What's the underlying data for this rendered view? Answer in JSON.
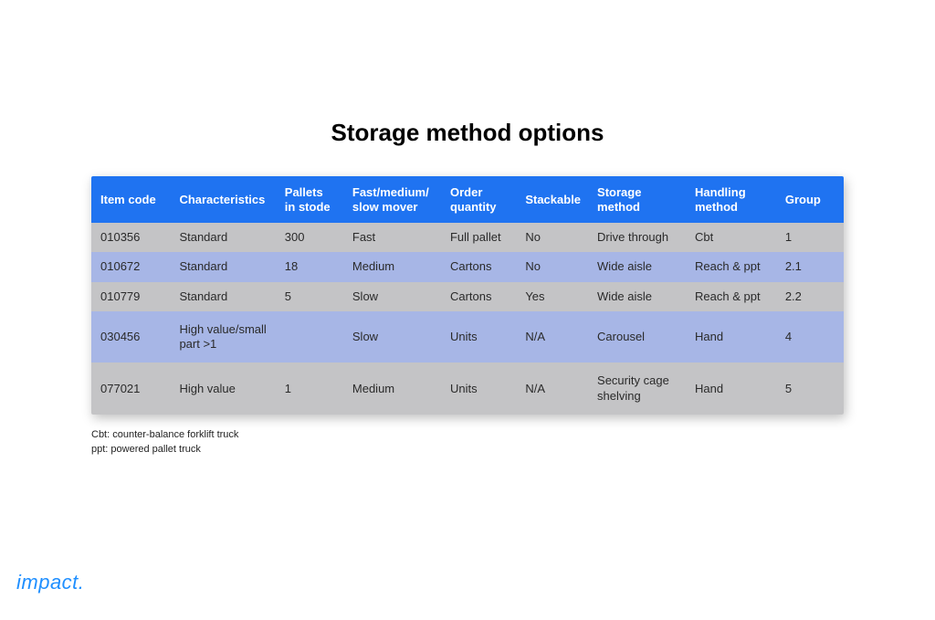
{
  "title": "Storage method options",
  "columns": [
    "Item code",
    "Characteristics",
    "Pallets in stode",
    "Fast/medium/ slow mover",
    "Order quantity",
    "Stackable",
    "Storage method",
    "Handling method",
    "Group"
  ],
  "rows": [
    {
      "item_code": "010356",
      "characteristics": "Standard",
      "pallets": "300",
      "mover": "Fast",
      "order_qty": "Full pallet",
      "stackable": "No",
      "storage": "Drive through",
      "handling": "Cbt",
      "group": "1"
    },
    {
      "item_code": "010672",
      "characteristics": "Standard",
      "pallets": "18",
      "mover": "Medium",
      "order_qty": "Cartons",
      "stackable": "No",
      "storage": "Wide aisle",
      "handling": "Reach & ppt",
      "group": "2.1"
    },
    {
      "item_code": "010779",
      "characteristics": "Standard",
      "pallets": "5",
      "mover": "Slow",
      "order_qty": "Cartons",
      "stackable": "Yes",
      "storage": "Wide aisle",
      "handling": "Reach & ppt",
      "group": "2.2"
    },
    {
      "item_code": "030456",
      "characteristics": "High value/small part >1",
      "pallets": "",
      "mover": "Slow",
      "order_qty": "Units",
      "stackable": "N/A",
      "storage": "Carousel",
      "handling": "Hand",
      "group": "4"
    },
    {
      "item_code": "077021",
      "characteristics": "High value",
      "pallets": "1",
      "mover": "Medium",
      "order_qty": "Units",
      "stackable": "N/A",
      "storage": "Security cage shelving",
      "handling": "Hand",
      "group": "5"
    }
  ],
  "footnotes": [
    "Cbt: counter-balance forklift truck",
    "ppt: powered pallet truck"
  ],
  "brand": "impact."
}
